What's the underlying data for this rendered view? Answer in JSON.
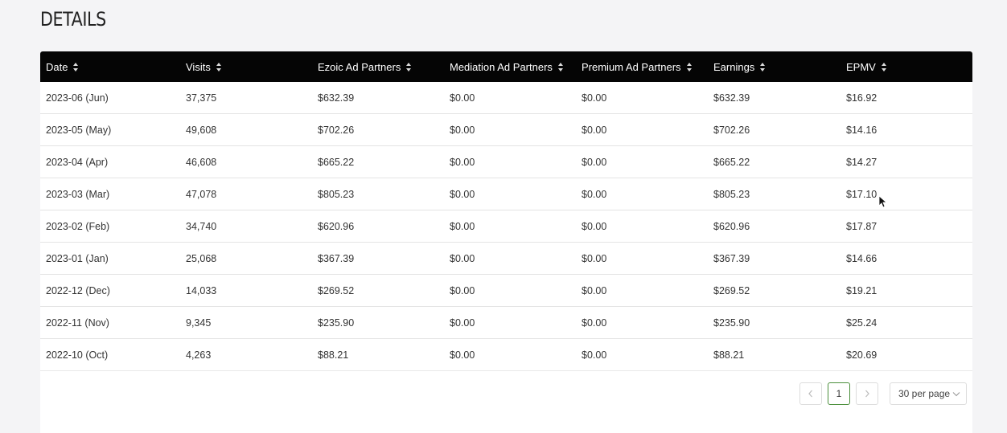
{
  "page": {
    "title": "DETAILS"
  },
  "table": {
    "columns": [
      "Date",
      "Visits",
      "Ezoic Ad Partners",
      "Mediation Ad Partners",
      "Premium Ad Partners",
      "Earnings",
      "EPMV"
    ],
    "rows": [
      [
        "2023-06 (Jun)",
        "37,375",
        "$632.39",
        "$0.00",
        "$0.00",
        "$632.39",
        "$16.92"
      ],
      [
        "2023-05 (May)",
        "49,608",
        "$702.26",
        "$0.00",
        "$0.00",
        "$702.26",
        "$14.16"
      ],
      [
        "2023-04 (Apr)",
        "46,608",
        "$665.22",
        "$0.00",
        "$0.00",
        "$665.22",
        "$14.27"
      ],
      [
        "2023-03 (Mar)",
        "47,078",
        "$805.23",
        "$0.00",
        "$0.00",
        "$805.23",
        "$17.10"
      ],
      [
        "2023-02 (Feb)",
        "34,740",
        "$620.96",
        "$0.00",
        "$0.00",
        "$620.96",
        "$17.87"
      ],
      [
        "2023-01 (Jan)",
        "25,068",
        "$367.39",
        "$0.00",
        "$0.00",
        "$367.39",
        "$14.66"
      ],
      [
        "2022-12 (Dec)",
        "14,033",
        "$269.52",
        "$0.00",
        "$0.00",
        "$269.52",
        "$19.21"
      ],
      [
        "2022-11 (Nov)",
        "9,345",
        "$235.90",
        "$0.00",
        "$0.00",
        "$235.90",
        "$25.24"
      ],
      [
        "2022-10 (Oct)",
        "4,263",
        "$88.21",
        "$0.00",
        "$0.00",
        "$88.21",
        "$20.69"
      ]
    ]
  },
  "pagination": {
    "prev_icon": "chevron-left-icon",
    "next_icon": "chevron-right-icon",
    "current_page": "1",
    "per_page": "30 per page"
  },
  "colors": {
    "header_bg": "#050505",
    "active_page_border": "#4b8f3c"
  }
}
